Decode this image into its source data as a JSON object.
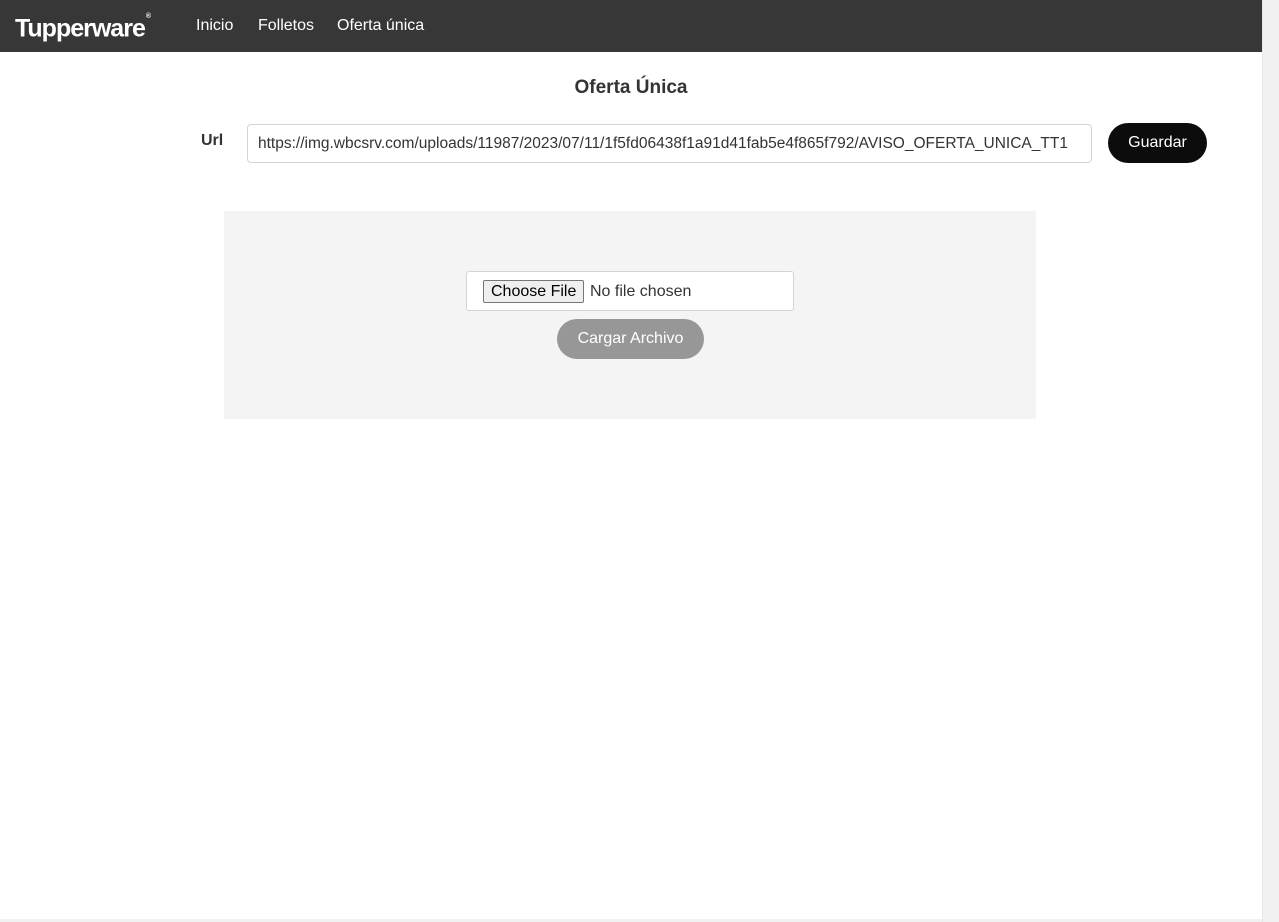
{
  "navbar": {
    "brand": "Tupperware",
    "brand_mark": "®",
    "links": [
      "Inicio",
      "Folletos",
      "Oferta única"
    ]
  },
  "main": {
    "title": "Oferta Única",
    "url_label": "Url",
    "url_value": "https://img.wbcsrv.com/uploads/11987/2023/07/11/1f5fd06438f1a91d41fab5e4f865f792/AVISO_OFERTA_UNICA_TT1",
    "save_label": "Guardar"
  },
  "upload": {
    "choose_file_label": "Choose File",
    "file_status": "No file chosen",
    "upload_label": "Cargar Archivo"
  },
  "colors": {
    "navbar_bg": "#373737",
    "primary_button": "#0c0c0c",
    "disabled_button": "#979797",
    "panel_bg": "#f4f4f4"
  }
}
